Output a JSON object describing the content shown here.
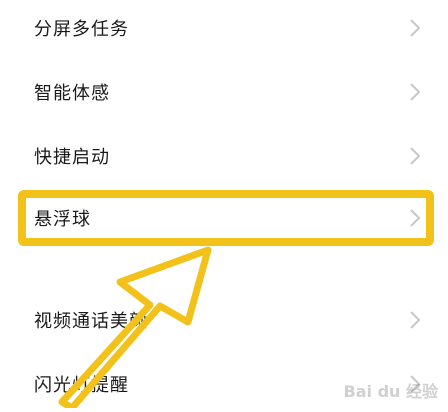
{
  "settings": {
    "items": [
      {
        "label": "分屏多任务"
      },
      {
        "label": "智能体感"
      },
      {
        "label": "快捷启动"
      },
      {
        "label": "悬浮球"
      },
      {
        "label": "视频通话美颜"
      },
      {
        "label": "闪光灯提醒"
      }
    ]
  },
  "annotation": {
    "color": "#f2c21b"
  },
  "watermark": {
    "text": "Bai du 经验"
  }
}
